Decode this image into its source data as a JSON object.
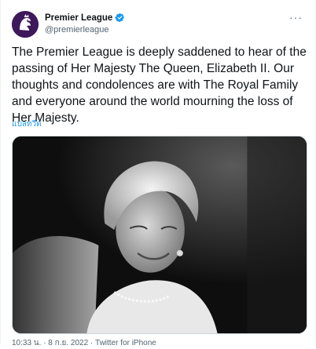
{
  "tweet": {
    "author_name": "Premier League",
    "author_handle": "@premierleague",
    "more_label": "···",
    "text": "The Premier League is deeply saddened to hear of the passing of Her Majesty The Queen, Elizabeth II. Our thoughts and condolences are with The Royal Family and everyone around the world mourning the loss of Her Majesty.",
    "translate_label": "แปลทวีต",
    "footer_text": "10:33 น. · 8 ก.ย. 2022 · Twitter for iPhone"
  },
  "colors": {
    "accent": "#1d9bf0",
    "brand": "#3d195b",
    "text": "#0f1419",
    "secondary": "#536471"
  },
  "icons": {
    "avatar": "premier-league-lion-logo",
    "verified": "verified-badge-icon",
    "more": "more-options-icon"
  }
}
